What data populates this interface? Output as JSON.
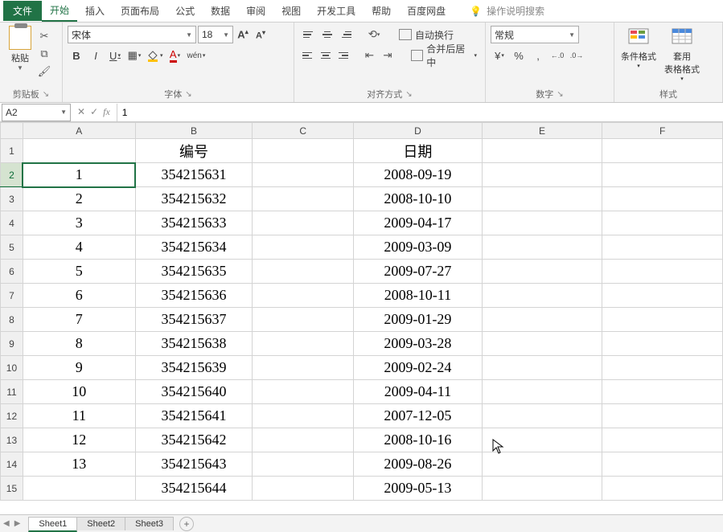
{
  "menu": {
    "file": "文件",
    "home": "开始",
    "insert": "插入",
    "layout": "页面布局",
    "formula": "公式",
    "data": "数据",
    "review": "审阅",
    "view": "视图",
    "dev": "开发工具",
    "help": "帮助",
    "baidu": "百度网盘",
    "search": "操作说明搜索"
  },
  "ribbon": {
    "clipboard": {
      "paste": "粘贴",
      "label": "剪贴板"
    },
    "font": {
      "name": "宋体",
      "size": "18",
      "grow": "A",
      "shrink": "A",
      "bold": "B",
      "italic": "I",
      "underline": "U",
      "wen": "wén",
      "fontcolor": "A",
      "label": "字体"
    },
    "align": {
      "wrap": "自动换行",
      "merge": "合并后居中",
      "label": "对齐方式"
    },
    "number": {
      "format": "常规",
      "percent": "%",
      "comma": ",",
      "inc": ".0←.00",
      "dec": ".00→.0",
      "label": "数字"
    },
    "styles": {
      "cond": "条件格式",
      "table": "套用\n表格格式",
      "label": "样式"
    }
  },
  "namebox": "A2",
  "formula": "1",
  "columns": [
    "A",
    "B",
    "C",
    "D",
    "E",
    "F"
  ],
  "header_row": {
    "B": "编号",
    "D": "日期"
  },
  "rows": [
    {
      "n": "1",
      "A": "1",
      "B": "354215631",
      "D": "2008-09-19"
    },
    {
      "n": "2",
      "A": "2",
      "B": "354215632",
      "D": "2008-10-10"
    },
    {
      "n": "3",
      "A": "3",
      "B": "354215633",
      "D": "2009-04-17"
    },
    {
      "n": "4",
      "A": "4",
      "B": "354215634",
      "D": "2009-03-09"
    },
    {
      "n": "5",
      "A": "5",
      "B": "354215635",
      "D": "2009-07-27"
    },
    {
      "n": "6",
      "A": "6",
      "B": "354215636",
      "D": "2008-10-11"
    },
    {
      "n": "7",
      "A": "7",
      "B": "354215637",
      "D": "2009-01-29"
    },
    {
      "n": "8",
      "A": "8",
      "B": "354215638",
      "D": "2009-03-28"
    },
    {
      "n": "9",
      "A": "9",
      "B": "354215639",
      "D": "2009-02-24"
    },
    {
      "n": "10",
      "A": "10",
      "B": "354215640",
      "D": "2009-04-11"
    },
    {
      "n": "11",
      "A": "11",
      "B": "354215641",
      "D": "2007-12-05"
    },
    {
      "n": "12",
      "A": "12",
      "B": "354215642",
      "D": "2008-10-16"
    },
    {
      "n": "13",
      "A": "13",
      "B": "354215643",
      "D": "2009-08-26"
    },
    {
      "n": "14",
      "A": "",
      "B": "354215644",
      "D": "2009-05-13"
    }
  ],
  "sheets": [
    "Sheet1",
    "Sheet2",
    "Sheet3"
  ]
}
